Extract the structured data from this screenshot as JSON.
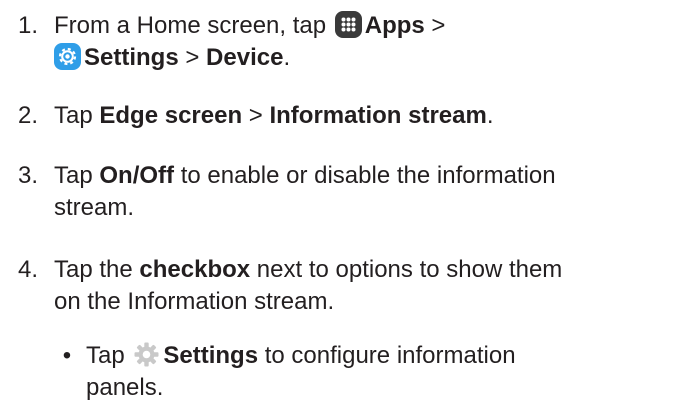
{
  "steps": [
    {
      "number": "1.",
      "line1": {
        "pre": "From a Home screen, tap ",
        "icon1": "apps-grid-icon",
        "apps": "Apps",
        "sep1": " >",
        "icon2": "settings-gear-icon",
        "settings": "Settings",
        "sep2": " > ",
        "device": "Device",
        "end": "."
      }
    },
    {
      "number": "2.",
      "pre": "Tap ",
      "b1": "Edge screen",
      "sep": " > ",
      "b2": "Information stream",
      "end": "."
    },
    {
      "number": "3.",
      "pre": "Tap ",
      "b1": "On/Off",
      "post1": " to enable or disable the information",
      "post2": "stream."
    },
    {
      "number": "4.",
      "pre": "Tap the ",
      "b1": "checkbox",
      "post1": " next to options to show them",
      "post2": "on the Information stream."
    }
  ],
  "sub_bullet": {
    "bullet": "•",
    "pre": "Tap ",
    "icon": "gear-outline-icon",
    "b1": "Settings",
    "post1": " to configure information",
    "post2": "panels."
  },
  "colors": {
    "text": "#231f20",
    "apps_icon": "#3a3a3a",
    "settings_icon": "#2f9ee8",
    "gear_icon": "#c9c9c9"
  }
}
